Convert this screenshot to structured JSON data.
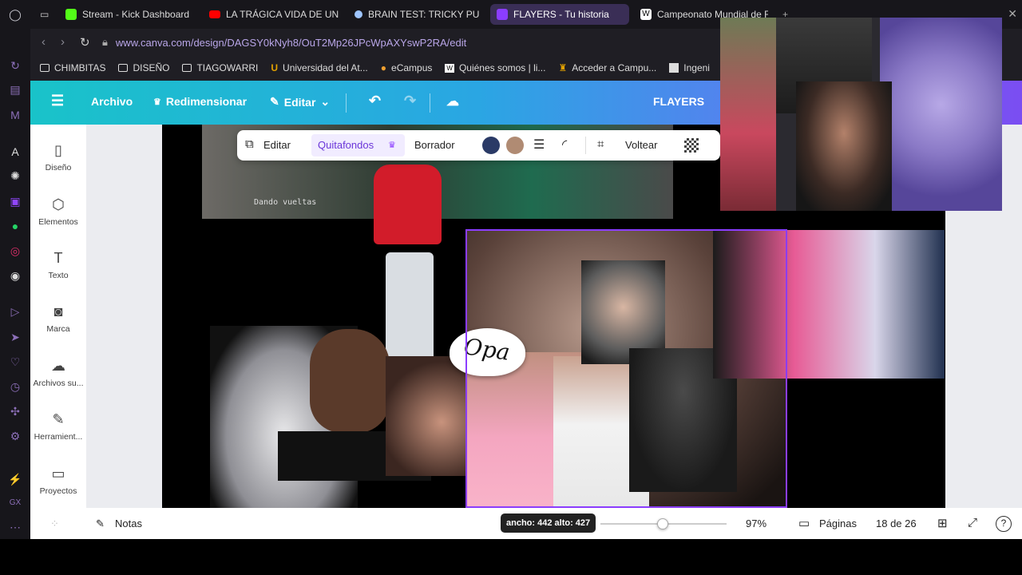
{
  "browser": {
    "tabs": [
      {
        "label": "Stream - Kick Dashboard",
        "color": "#53fc18"
      },
      {
        "label": "LA TRÁGICA VIDA DE UN",
        "color": "#ff0000"
      },
      {
        "label": "BRAIN TEST: TRICKY PU",
        "color": "#9ec5ff"
      },
      {
        "label": "FLAYERS - Tu historia",
        "color": "#8b3dff",
        "active": true
      },
      {
        "label": "Campeonato Mundial de F",
        "color": "#ffffff"
      }
    ],
    "url": "www.canva.com/design/DAGSY0kNyh8/OuT2Mp26JPcWpAXYswP2RA/edit",
    "bookmarks": [
      {
        "label": "CHIMBITAS",
        "icon": "folder-icon"
      },
      {
        "label": "DISEÑO",
        "icon": "folder-icon"
      },
      {
        "label": "TIAGOWARRI",
        "icon": "folder-icon"
      },
      {
        "label": "Universidad del At...",
        "icon": "university-icon"
      },
      {
        "label": "eCampus",
        "icon": "ecampus-icon"
      },
      {
        "label": "Quiénes somos | li...",
        "icon": "wix-icon"
      },
      {
        "label": "Acceder a Campu...",
        "icon": "campus-icon"
      },
      {
        "label": "Ingeni",
        "icon": "page-icon"
      }
    ]
  },
  "canva": {
    "header": {
      "archivo": "Archivo",
      "redimensionar": "Redimensionar",
      "editar": "Editar",
      "title": "FLAYERS"
    },
    "sidebar": [
      {
        "label": "Diseño",
        "icon": "layout-icon"
      },
      {
        "label": "Elementos",
        "icon": "shapes-icon"
      },
      {
        "label": "Texto",
        "icon": "text-icon"
      },
      {
        "label": "Marca",
        "icon": "brand-icon"
      },
      {
        "label": "Archivos su...",
        "icon": "cloud-upload-icon"
      },
      {
        "label": "Herramient...",
        "icon": "tools-icon"
      },
      {
        "label": "Proyectos",
        "icon": "folder-icon"
      }
    ],
    "toolbar": {
      "editar": "Editar",
      "quitafondos": "Quitafondos",
      "borrador": "Borrador",
      "voltear": "Voltear",
      "color_1": "#2a3a66",
      "color_2": "#b08b73"
    },
    "canvas": {
      "caption_text": "Dando vueltas",
      "sticker_text": "Opa"
    },
    "bottom": {
      "notas": "Notas",
      "size_tooltip": "ancho: 442 alto: 427",
      "zoom": "97%",
      "paginas": "Páginas",
      "page_counter": "18 de 26"
    }
  }
}
